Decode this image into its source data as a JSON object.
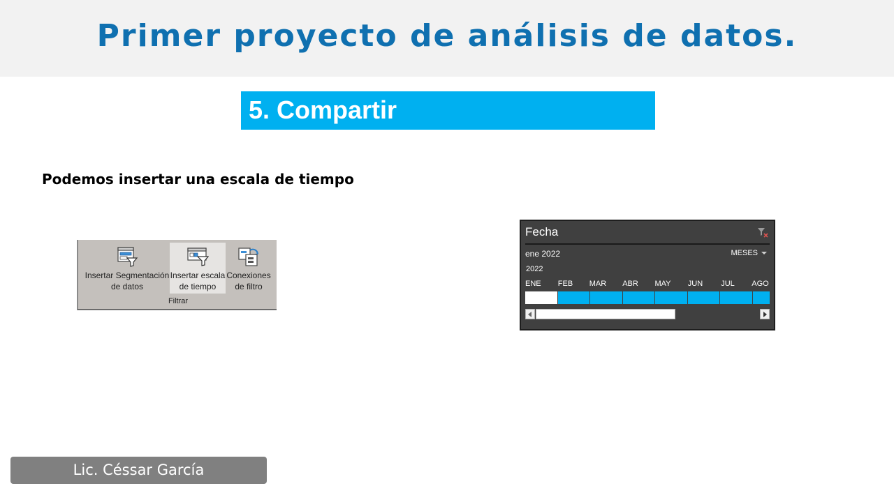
{
  "header": {
    "title": "Primer proyecto de análisis de datos."
  },
  "section": {
    "title": "5. Compartir"
  },
  "subtitle": "Podemos insertar una escala de tiempo",
  "ribbon": {
    "buttons": [
      {
        "label": "Insertar Segmentación de datos",
        "icon": "slicer-icon"
      },
      {
        "label": "Insertar escala de tiempo",
        "icon": "timeline-icon",
        "highlighted": true
      },
      {
        "label": "Conexiones de filtro",
        "icon": "filter-connections-icon"
      }
    ],
    "group_label": "Filtrar"
  },
  "timeline": {
    "header": "Fecha",
    "range_label": "ene 2022",
    "time_level": "MESES",
    "year": "2022",
    "months": [
      "ENE",
      "FEB",
      "MAR",
      "ABR",
      "MAY",
      "JUN",
      "JUL",
      "AGO"
    ],
    "selected_month": "ENE",
    "colors": {
      "bar": "#00b0f0",
      "selected": "#ffffff",
      "background": "#404040"
    }
  },
  "footer": {
    "author": "Lic. Céssar García"
  }
}
